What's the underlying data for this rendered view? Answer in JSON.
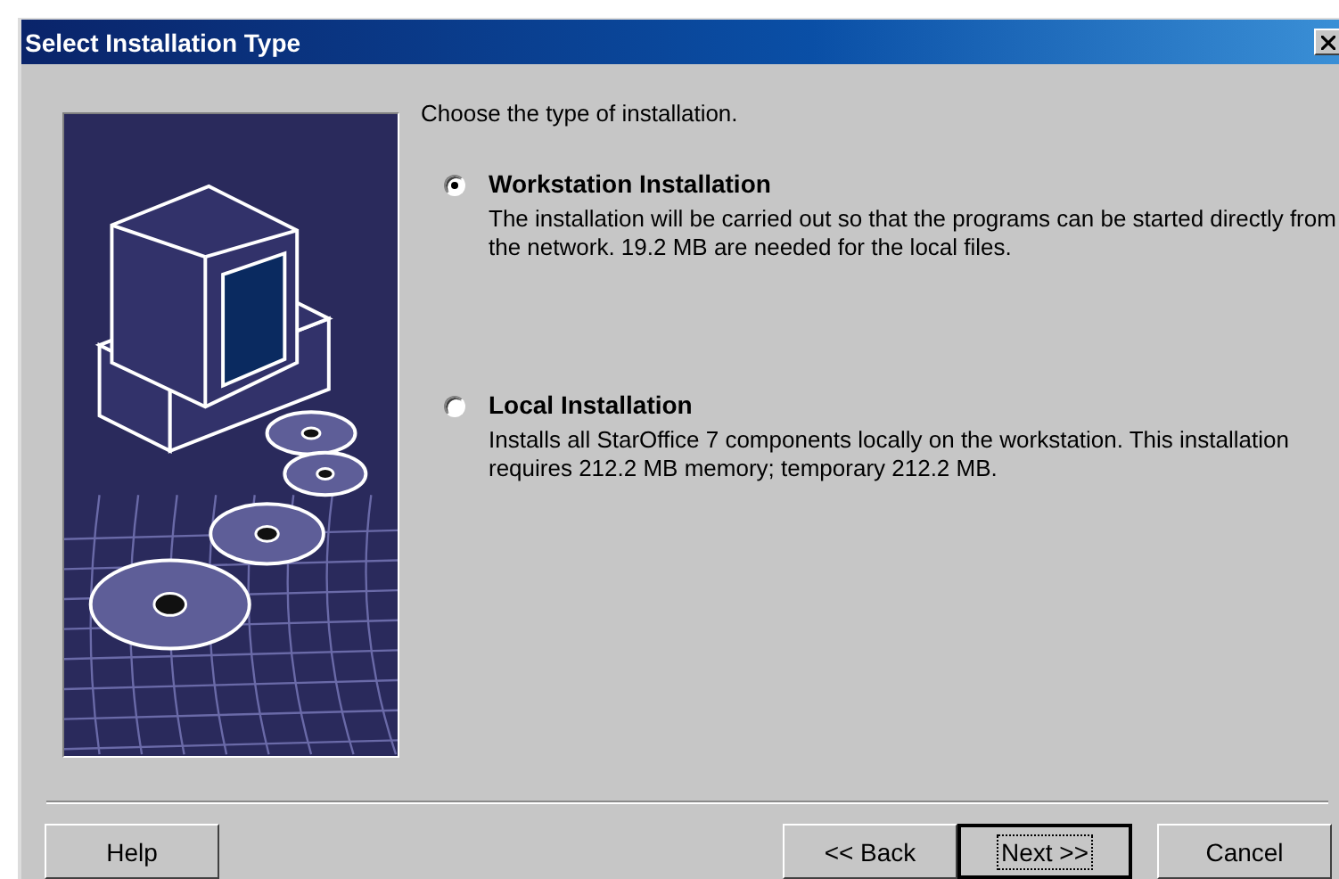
{
  "window": {
    "title": "Select Installation Type"
  },
  "instruction": "Choose the type of installation.",
  "options": [
    {
      "label": "Workstation Installation",
      "description": "The installation will be carried out so that the programs can be started directly from the network. 19.2 MB are needed for the local files.",
      "selected": true
    },
    {
      "label": "Local Installation",
      "description": "Installs all StarOffice 7 components locally on the workstation. This installation requires 212.2 MB memory; temporary 212.2 MB.",
      "selected": false
    }
  ],
  "buttons": [
    {
      "label": "Help",
      "kind": "help",
      "default": false
    },
    {
      "label": "<< Back",
      "kind": "nav",
      "default": false
    },
    {
      "label": "Next >>",
      "kind": "nav",
      "default": true
    },
    {
      "label": "Cancel",
      "kind": "cancel",
      "default": false
    }
  ]
}
